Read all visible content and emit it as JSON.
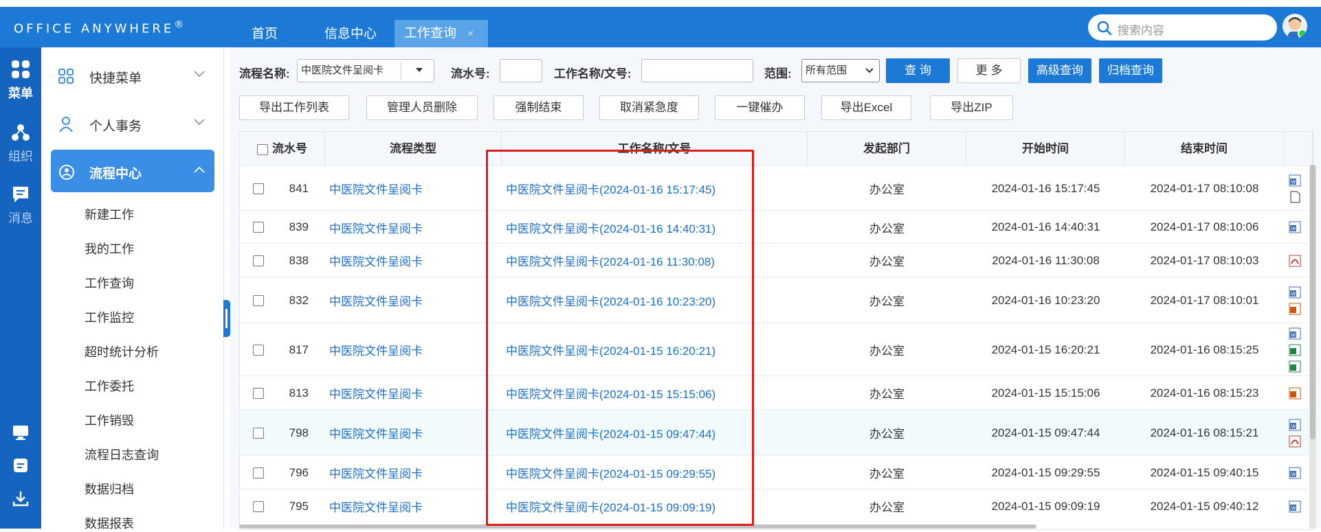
{
  "app": {
    "logo": "Office Anywhere",
    "logo_mark": "®",
    "tabs": [
      {
        "label": "首页"
      },
      {
        "label": "信息中心"
      },
      {
        "label": "工作查询",
        "close": "×"
      }
    ],
    "search_placeholder": "搜索内容"
  },
  "rail": {
    "items": [
      {
        "label": "菜单",
        "icon": "grid-icon"
      },
      {
        "label": "组织",
        "icon": "org-icon"
      },
      {
        "label": "消息",
        "icon": "message-icon"
      }
    ],
    "bottom_icons": [
      "monitor-icon",
      "note-icon",
      "download-icon"
    ]
  },
  "sidebar": {
    "menus": [
      {
        "label": "快捷菜单",
        "icon": "shortcut-icon"
      },
      {
        "label": "个人事务",
        "icon": "person-icon"
      },
      {
        "label": "流程中心",
        "icon": "workflow-icon"
      }
    ],
    "subitems": [
      "新建工作",
      "我的工作",
      "工作查询",
      "工作监控",
      "超时统计分析",
      "工作委托",
      "工作销毁",
      "流程日志查询",
      "数据归档",
      "数据报表"
    ]
  },
  "filters": {
    "flow_name_label": "流程名称:",
    "flow_name_value": "中医院文件呈阅卡",
    "serial_label": "流水号:",
    "serial_value": "",
    "work_name_label": "工作名称/文号:",
    "work_name_value": "",
    "range_label": "范围:",
    "range_value": "所有范围",
    "buttons": {
      "query": "查 询",
      "more": "更 多",
      "advanced": "高级查询",
      "archive": "归档查询"
    }
  },
  "actions": [
    "导出工作列表",
    "管理人员删除",
    "强制结束",
    "取消紧急度",
    "一键催办",
    "导出Excel",
    "导出ZIP"
  ],
  "table": {
    "columns": [
      "流水号",
      "流程类型",
      "工作名称/文号",
      "发起部门",
      "开始时间",
      "结束时间"
    ],
    "rows": [
      {
        "id": "841",
        "type": "中医院文件呈阅卡",
        "name": "中医院文件呈阅卡(2024-01-16 15:17:45)",
        "dept": "办公室",
        "start": "2024-01-16 15:17:45",
        "end": "2024-01-17 08:10:08"
      },
      {
        "id": "839",
        "type": "中医院文件呈阅卡",
        "name": "中医院文件呈阅卡(2024-01-16 14:40:31)",
        "dept": "办公室",
        "start": "2024-01-16 14:40:31",
        "end": "2024-01-17 08:10:06"
      },
      {
        "id": "838",
        "type": "中医院文件呈阅卡",
        "name": "中医院文件呈阅卡(2024-01-16 11:30:08)",
        "dept": "办公室",
        "start": "2024-01-16 11:30:08",
        "end": "2024-01-17 08:10:03"
      },
      {
        "id": "832",
        "type": "中医院文件呈阅卡",
        "name": "中医院文件呈阅卡(2024-01-16 10:23:20)",
        "dept": "办公室",
        "start": "2024-01-16 10:23:20",
        "end": "2024-01-17 08:10:01"
      },
      {
        "id": "817",
        "type": "中医院文件呈阅卡",
        "name": "中医院文件呈阅卡(2024-01-15 16:20:21)",
        "dept": "办公室",
        "start": "2024-01-15 16:20:21",
        "end": "2024-01-16 08:15:25"
      },
      {
        "id": "813",
        "type": "中医院文件呈阅卡",
        "name": "中医院文件呈阅卡(2024-01-15 15:15:06)",
        "dept": "办公室",
        "start": "2024-01-15 15:15:06",
        "end": "2024-01-16 08:15:23"
      },
      {
        "id": "798",
        "type": "中医院文件呈阅卡",
        "name": "中医院文件呈阅卡(2024-01-15 09:47:44)",
        "dept": "办公室",
        "start": "2024-01-15 09:47:44",
        "end": "2024-01-16 08:15:21"
      },
      {
        "id": "796",
        "type": "中医院文件呈阅卡",
        "name": "中医院文件呈阅卡(2024-01-15 09:29:55)",
        "dept": "办公室",
        "start": "2024-01-15 09:29:55",
        "end": "2024-01-15 09:40:15"
      },
      {
        "id": "795",
        "type": "中医院文件呈阅卡",
        "name": "中医院文件呈阅卡(2024-01-15 09:09:19)",
        "dept": "办公室",
        "start": "2024-01-15 09:09:19",
        "end": "2024-01-15 09:40:12"
      }
    ]
  },
  "colors": {
    "brand": "#1c7ad6",
    "rail": "#1565c0",
    "link": "#1c6fc9",
    "highlight": "#e01b1b"
  }
}
